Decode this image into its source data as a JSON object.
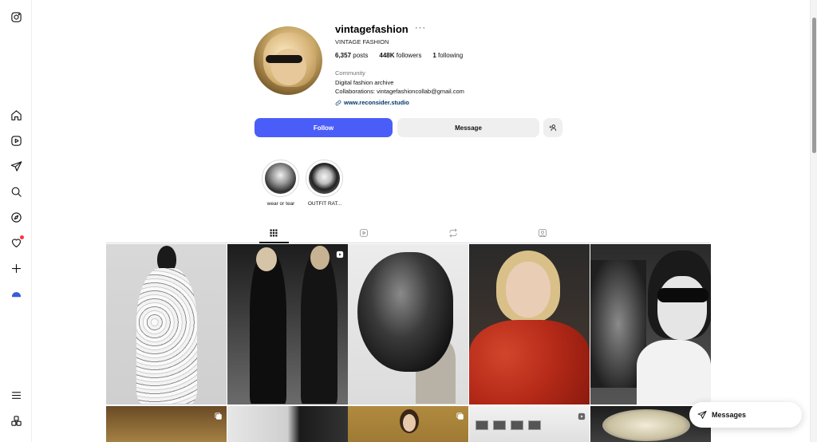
{
  "nav": {
    "items": [
      "instagram-logo",
      "home",
      "reels",
      "direct",
      "search",
      "explore",
      "notifications",
      "create",
      "profile",
      "more",
      "also-from-meta"
    ]
  },
  "profile": {
    "username": "vintagefashion",
    "more": "···",
    "full_name": "VINTAGE FASHION",
    "stats": {
      "posts_count": "6,357",
      "posts_label": "posts",
      "followers_count": "448K",
      "followers_label": "followers",
      "following_count": "1",
      "following_label": "following"
    },
    "category": "Community",
    "bio_line1": "Digital fashion archive",
    "bio_line2": "Collaborations: vintagefashioncollab@gmail.com",
    "website": "www.reconsider.studio"
  },
  "actions": {
    "follow": "Follow",
    "message": "Message"
  },
  "highlights": [
    {
      "label": "wear or tear"
    },
    {
      "label": "OUTFIT RAT..."
    }
  ],
  "tabs": [
    "posts",
    "reels",
    "reposts",
    "tagged"
  ],
  "messages_pill": {
    "label": "Messages"
  }
}
